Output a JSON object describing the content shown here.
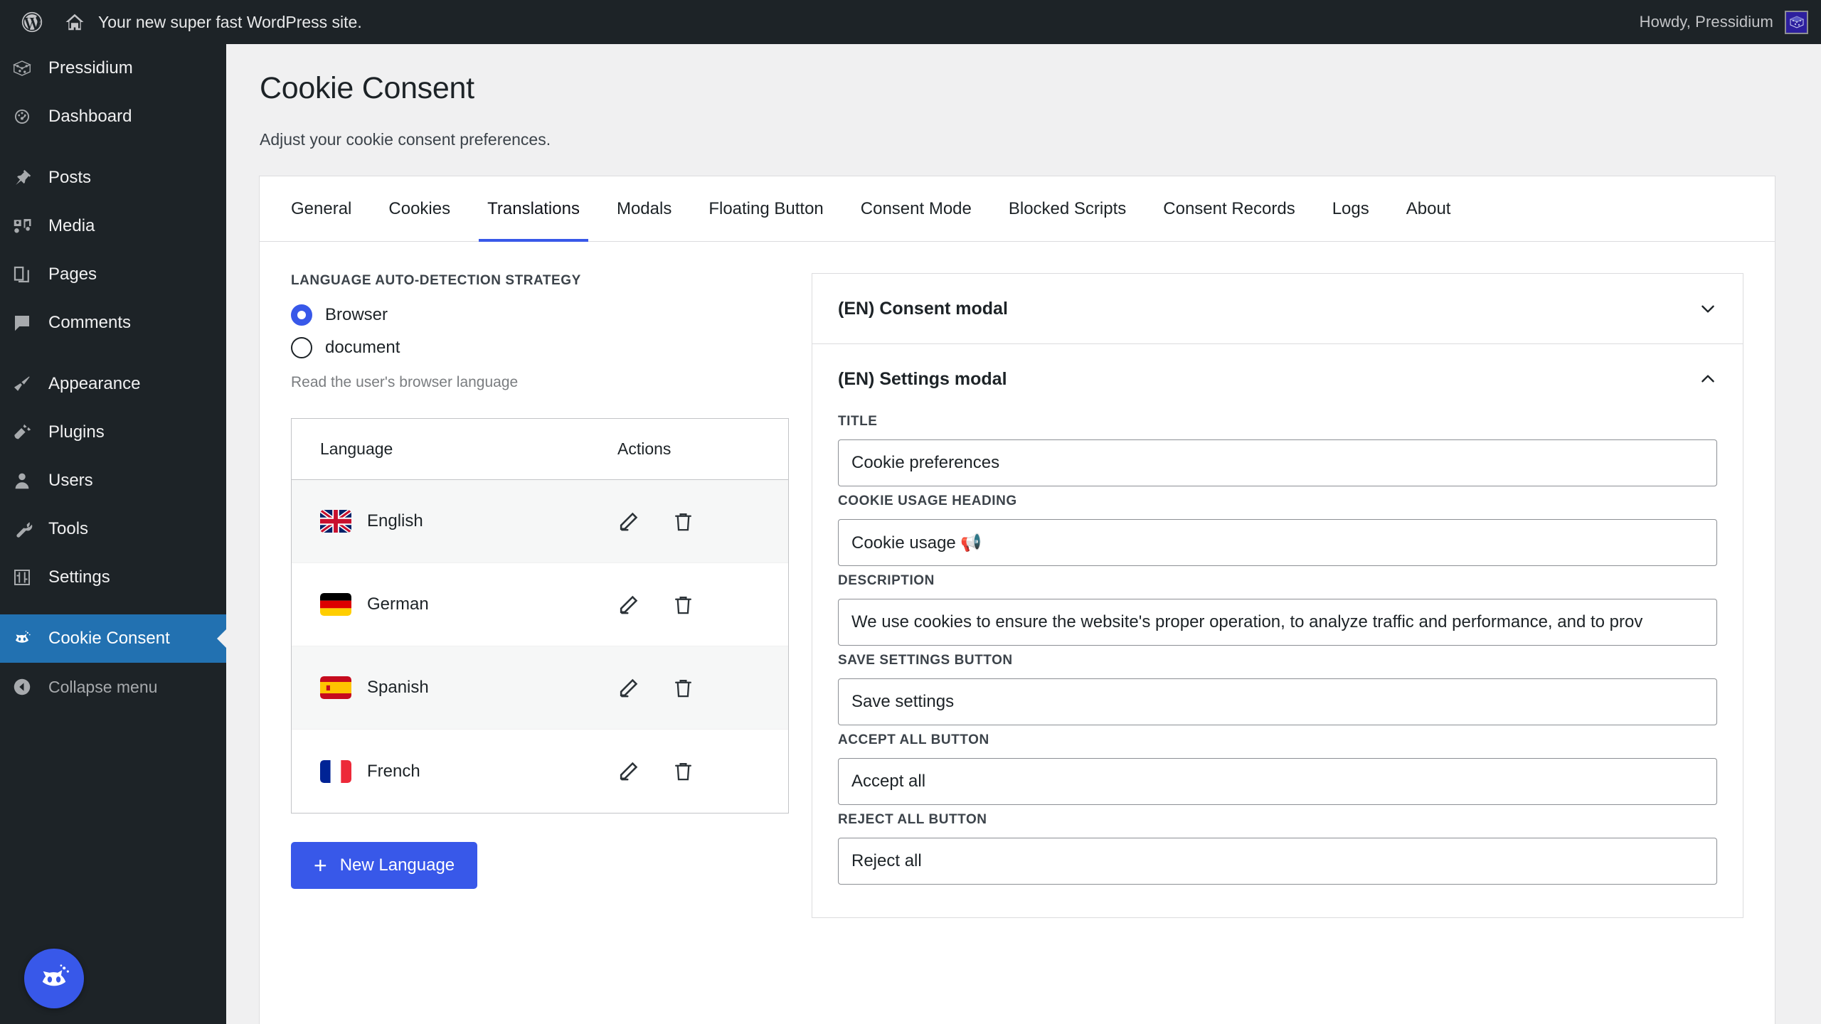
{
  "adminbar": {
    "wp_logo_icon": "wordpress-icon",
    "home_icon": "home-icon",
    "site_name": "Your new super fast WordPress site.",
    "howdy": "Howdy, Pressidium",
    "avatar_icon": "pressidium-avatar-icon"
  },
  "sidebar": {
    "items": [
      {
        "label": "Pressidium",
        "icon": "pressidium-icon",
        "current": false
      },
      {
        "label": "Dashboard",
        "icon": "dashboard-icon",
        "current": false
      },
      {
        "label": "Posts",
        "icon": "pin-icon",
        "current": false
      },
      {
        "label": "Media",
        "icon": "media-icon",
        "current": false
      },
      {
        "label": "Pages",
        "icon": "pages-icon",
        "current": false
      },
      {
        "label": "Comments",
        "icon": "comments-icon",
        "current": false
      },
      {
        "label": "Appearance",
        "icon": "appearance-brush-icon",
        "current": false
      },
      {
        "label": "Plugins",
        "icon": "plugins-plug-icon",
        "current": false
      },
      {
        "label": "Users",
        "icon": "users-icon",
        "current": false
      },
      {
        "label": "Tools",
        "icon": "tools-wrench-icon",
        "current": false
      },
      {
        "label": "Settings",
        "icon": "settings-sliders-icon",
        "current": false
      },
      {
        "label": "Cookie Consent",
        "icon": "cookie-consent-cat-icon",
        "current": true
      }
    ],
    "collapse": {
      "label": "Collapse menu",
      "icon": "collapse-arrow-icon"
    },
    "floating_widget_icon": "cookie-consent-cat-icon"
  },
  "page": {
    "title": "Cookie Consent",
    "subtitle": "Adjust your cookie consent preferences."
  },
  "tabs": [
    {
      "label": "General",
      "active": false
    },
    {
      "label": "Cookies",
      "active": false
    },
    {
      "label": "Translations",
      "active": true
    },
    {
      "label": "Modals",
      "active": false
    },
    {
      "label": "Floating Button",
      "active": false
    },
    {
      "label": "Consent Mode",
      "active": false
    },
    {
      "label": "Blocked Scripts",
      "active": false
    },
    {
      "label": "Consent Records",
      "active": false
    },
    {
      "label": "Logs",
      "active": false
    },
    {
      "label": "About",
      "active": false
    }
  ],
  "left_panel": {
    "strategy_label": "LANGUAGE AUTO-DETECTION STRATEGY",
    "options": [
      {
        "label": "Browser",
        "checked": true
      },
      {
        "label": "document",
        "checked": false
      }
    ],
    "help_text": "Read the user's browser language",
    "table": {
      "columns": [
        "Language",
        "Actions"
      ],
      "rows": [
        {
          "language": "English",
          "flag": "uk-flag",
          "edit_icon": "pencil-icon",
          "delete_icon": "trash-icon"
        },
        {
          "language": "German",
          "flag": "germany-flag",
          "edit_icon": "pencil-icon",
          "delete_icon": "trash-icon"
        },
        {
          "language": "Spanish",
          "flag": "spain-flag",
          "edit_icon": "pencil-icon",
          "delete_icon": "trash-icon"
        },
        {
          "language": "French",
          "flag": "france-flag",
          "edit_icon": "pencil-icon",
          "delete_icon": "trash-icon"
        }
      ]
    },
    "new_language_button": "New Language",
    "new_language_plus": "+"
  },
  "right_panel": {
    "accordions": [
      {
        "title": "(EN) Consent modal",
        "expanded": false,
        "chevron": "chevron-down-icon"
      },
      {
        "title": "(EN) Settings modal",
        "expanded": true,
        "chevron": "chevron-up-icon"
      }
    ],
    "fields": [
      {
        "label": "TITLE",
        "value": "Cookie preferences"
      },
      {
        "label": "COOKIE USAGE HEADING",
        "value": "Cookie usage 📢"
      },
      {
        "label": "DESCRIPTION",
        "value": "We use cookies to ensure the website's proper operation, to analyze traffic and performance, and to prov"
      },
      {
        "label": "SAVE SETTINGS BUTTON",
        "value": "Save settings"
      },
      {
        "label": "ACCEPT ALL BUTTON",
        "value": "Accept all"
      },
      {
        "label": "REJECT ALL BUTTON",
        "value": "Reject all"
      }
    ]
  },
  "colors": {
    "accent_blue": "#3858e9",
    "sidebar_bg": "#1d2327",
    "current_menu_bg": "#2271b1",
    "page_bg": "#f0f0f1"
  }
}
